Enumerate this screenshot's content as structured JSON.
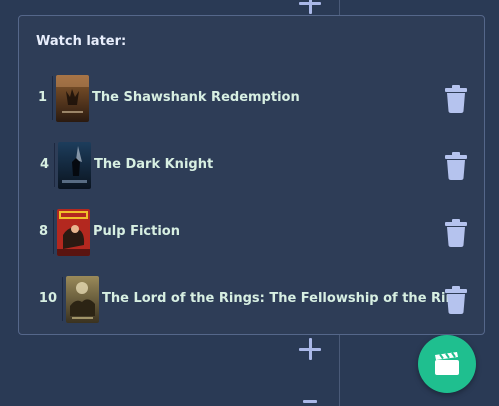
{
  "panel": {
    "title": "Watch later:",
    "items": [
      {
        "rank": "1",
        "title": "The Shawshank Redemption"
      },
      {
        "rank": "4",
        "title": "The Dark Knight"
      },
      {
        "rank": "8",
        "title": "Pulp Fiction"
      },
      {
        "rank": "10",
        "title": "The Lord of the Rings: The Fellowship of the Ring"
      }
    ]
  },
  "icons": {
    "trash": "trash-icon",
    "add": "plus-icon",
    "fab": "clapperboard-icon"
  },
  "colors": {
    "background": "#2a3a55",
    "panel": "#2e3d57",
    "text": "#d7efe2",
    "trash": "#b5c3ee",
    "fab": "#1fbf8f"
  }
}
